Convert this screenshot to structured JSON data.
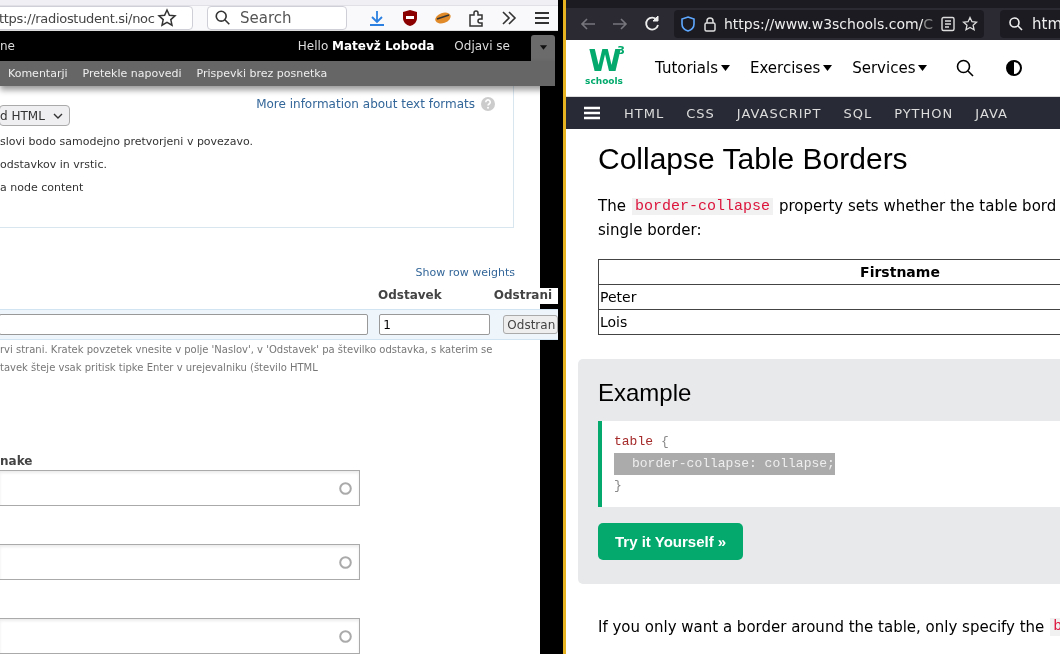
{
  "left_browser": {
    "toolbar": {
      "url": "ttps://radiostudent.si/noc",
      "search_placeholder": "Search"
    },
    "site_bar": {
      "left_text": "ne",
      "greeting": "Hello **Matevž Loboda**",
      "logout": "Odjavi se"
    },
    "menu": [
      {
        "label": "Komentarji"
      },
      {
        "label": "Pretekle napovedi"
      },
      {
        "label": "Prispevki brez posnetka"
      }
    ],
    "text_format": {
      "select_value": "d HTML",
      "help_link": "More information about text formats",
      "tips": [
        "slovi bodo samodejno pretvorjeni v povezavo.",
        "odstavkov in vrstic.",
        "a node content"
      ]
    },
    "paragraphs": {
      "show_weights": "Show row weights",
      "columns": [
        "Odstavek",
        "Odstrani"
      ],
      "rows": [
        {
          "paragraph": "1",
          "remove": "Odstran"
        }
      ],
      "description": [
        "rvi strani. Kratek povzetek vnesite v polje 'Naslov', v 'Odstavek' pa številko odstavka, s katerim se",
        "tavek šteje vsak pritisk tipke Enter v urejevalniku (število HTML"
      ]
    },
    "field_label": "nake",
    "fields": [
      {
        "kind": "autocomplete"
      },
      {
        "kind": "autocomplete"
      },
      {
        "kind": "autocomplete"
      }
    ]
  },
  "right_browser": {
    "nav_buttons": [
      {
        "kind": "back",
        "disabled": true
      },
      {
        "kind": "forward",
        "disabled": true
      },
      {
        "kind": "reload",
        "disabled": false
      }
    ],
    "toolbar": {
      "url_host": "https://www.w3schools.com/",
      "url_rest": "C",
      "search_text": "htm"
    },
    "logo": {
      "mark": "W",
      "superscript": "3",
      "wordmark": "schools"
    },
    "header_menu": [
      {
        "label": "Tutorials"
      },
      {
        "label": "Exercises"
      },
      {
        "label": "Services"
      }
    ],
    "topnav": [
      {
        "label": "HTML"
      },
      {
        "label": "CSS"
      },
      {
        "label": "JAVASCRIPT"
      },
      {
        "label": "SQL"
      },
      {
        "label": "PYTHON"
      },
      {
        "label": "JAVA"
      }
    ],
    "title": "Collapse Table Borders",
    "intro": {
      "before": "The",
      "code": "border-collapse",
      "after": "property sets whether the table bord",
      "line2": "single border:"
    },
    "table": {
      "columns": [
        "Firstname"
      ],
      "rows": [
        [
          "Peter"
        ],
        [
          "Lois"
        ]
      ]
    },
    "example": {
      "title": "Example",
      "lines": [
        {
          "kind": "rule_open",
          "selector": "table",
          "brace": "{",
          "selected": false
        },
        {
          "kind": "declaration",
          "text": "border-collapse: collapse;",
          "selected": true
        },
        {
          "kind": "rule_close",
          "text": "}",
          "selected": false
        }
      ],
      "button": "Try it Yourself »"
    },
    "outro": {
      "text": "If you only want a border around the table, only specify the",
      "code": "b"
    }
  }
}
